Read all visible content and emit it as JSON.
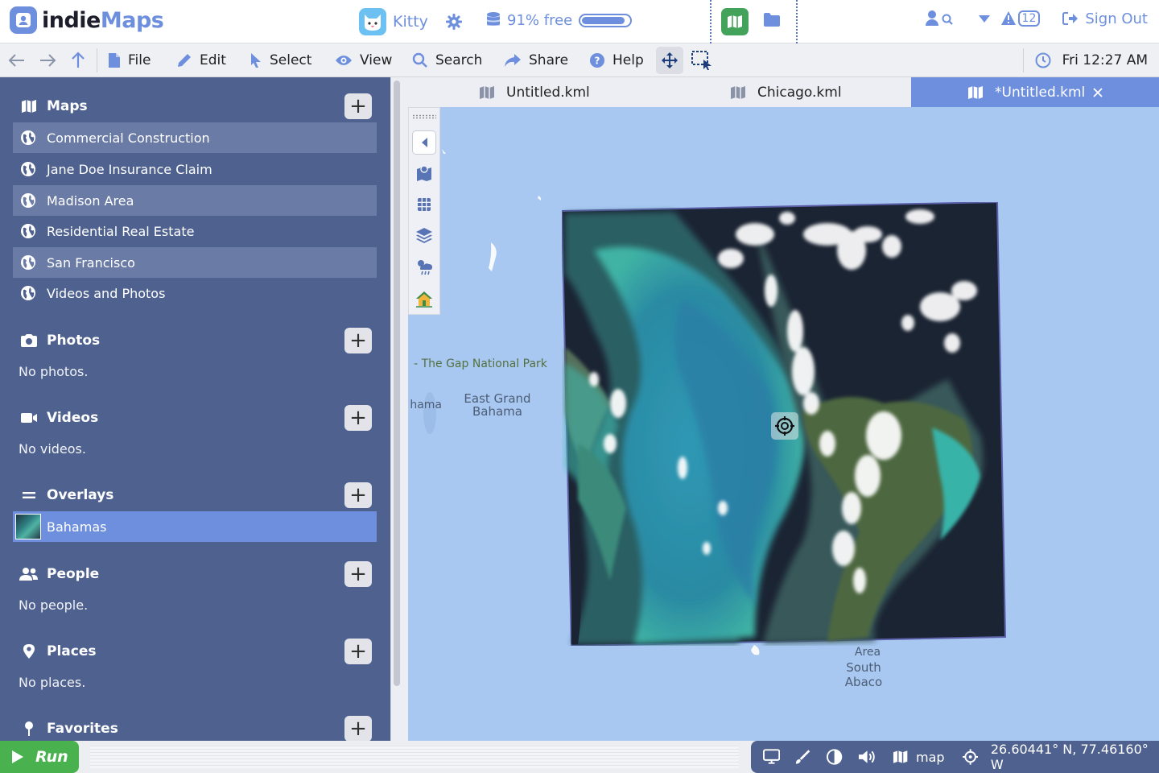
{
  "header": {
    "logo_part1": "indie",
    "logo_part2": "Maps",
    "username": "Kitty",
    "storage_text": "91% free",
    "storage_fraction": 0.91,
    "notification_count": "12",
    "sign_out_label": "Sign Out"
  },
  "toolbar": {
    "file": "File",
    "edit": "Edit",
    "select": "Select",
    "view": "View",
    "search": "Search",
    "share": "Share",
    "help": "Help",
    "clock": "Fri 12:27 AM"
  },
  "sidebar": {
    "maps": {
      "title": "Maps",
      "items": [
        {
          "label": "Commercial Construction"
        },
        {
          "label": "Jane Doe Insurance Claim"
        },
        {
          "label": "Madison Area"
        },
        {
          "label": "Residential Real Estate"
        },
        {
          "label": "San Francisco"
        },
        {
          "label": "Videos and Photos"
        }
      ]
    },
    "photos": {
      "title": "Photos",
      "empty": "No photos."
    },
    "videos": {
      "title": "Videos",
      "empty": "No videos."
    },
    "overlays": {
      "title": "Overlays",
      "items": [
        {
          "label": "Bahamas"
        }
      ]
    },
    "people": {
      "title": "People",
      "empty": "No people."
    },
    "places": {
      "title": "Places",
      "empty": "No places."
    },
    "favorites": {
      "title": "Favorites"
    }
  },
  "tabs": [
    {
      "label": "Untitled.kml"
    },
    {
      "label": "Chicago.kml"
    },
    {
      "label": "*Untitled.kml"
    }
  ],
  "map": {
    "labels": {
      "gap_park": "- The Gap National Park",
      "hama": "hama",
      "east_grand_1": "East Grand",
      "east_grand_2": "Bahama",
      "conservation_area": "Area",
      "south_abaco_1": "South",
      "south_abaco_2": "Abaco"
    }
  },
  "statusbar": {
    "run_label": "Run",
    "mode": "map",
    "coordinates": "26.60441° N, 77.46160° W"
  },
  "colors": {
    "accent": "#6d8fdd",
    "sidebar": "#4f628f",
    "run_green": "#49b24f",
    "map_water": "#a8c8f2"
  }
}
